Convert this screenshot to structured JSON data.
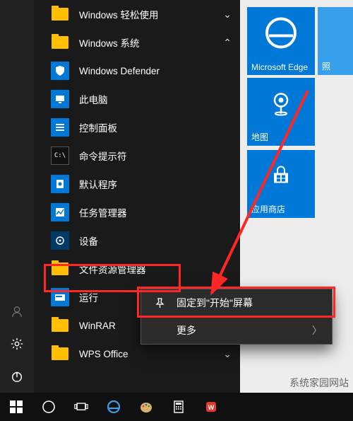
{
  "apps": {
    "easy": "Windows 轻松使用",
    "system": "Windows 系统",
    "defender": "Windows Defender",
    "thispc": "此电脑",
    "cpanel": "控制面板",
    "cmd": "命令提示符",
    "defprog": "默认程序",
    "taskmgr": "任务管理器",
    "devices": "设备",
    "explorer": "文件资源管理器",
    "run": "运行",
    "winrar": "WinRAR",
    "wps": "WPS Office"
  },
  "ctx": {
    "pin": "固定到\"开始\"屏幕",
    "more": "更多"
  },
  "tiles": {
    "edge": "Microsoft Edge",
    "photos": "照",
    "map": "地图",
    "store": "应用商店"
  },
  "watermark": "系统家园网站"
}
